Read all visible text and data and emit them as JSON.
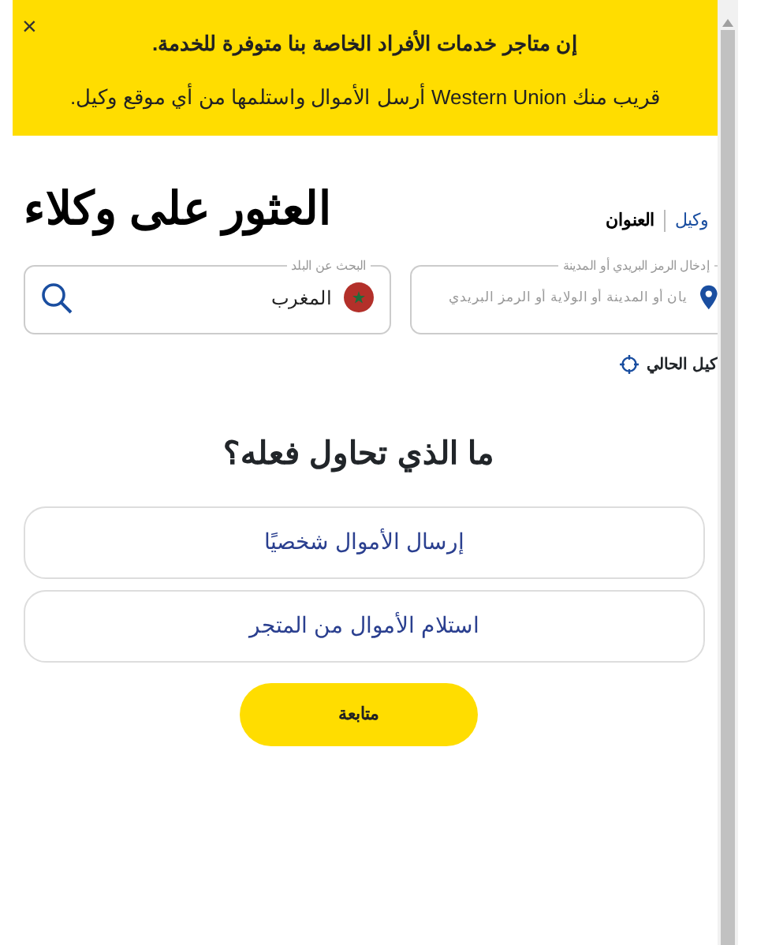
{
  "banner": {
    "title": "إن متاجر خدمات الأفراد الخاصة بنا متوفرة للخدمة.",
    "message": "قريب منك Western Union أرسل الأموال واستلمها من أي موقع وكيل.",
    "close": "×"
  },
  "heading": "العثور على وكلاء",
  "tabs": [
    {
      "label": "وكيل",
      "selected": false
    },
    {
      "label": "العنوان",
      "selected": true
    }
  ],
  "location_field": {
    "label": "إدخال الرمز البريدي أو المدينة",
    "placeholder": "يان أو المدينة أو الولاية أو الرمز البريدي"
  },
  "country_field": {
    "label": "البحث عن البلد",
    "value": "المغرب"
  },
  "current_location_link": "كيل الحالي",
  "question": "ما الذي تحاول فعله؟",
  "options": [
    {
      "label": "إرسال الأموال شخصيًا",
      "selected": false
    },
    {
      "label": "استلام الأموال من المتجر",
      "selected": false
    }
  ],
  "continue_button": "متابعة"
}
